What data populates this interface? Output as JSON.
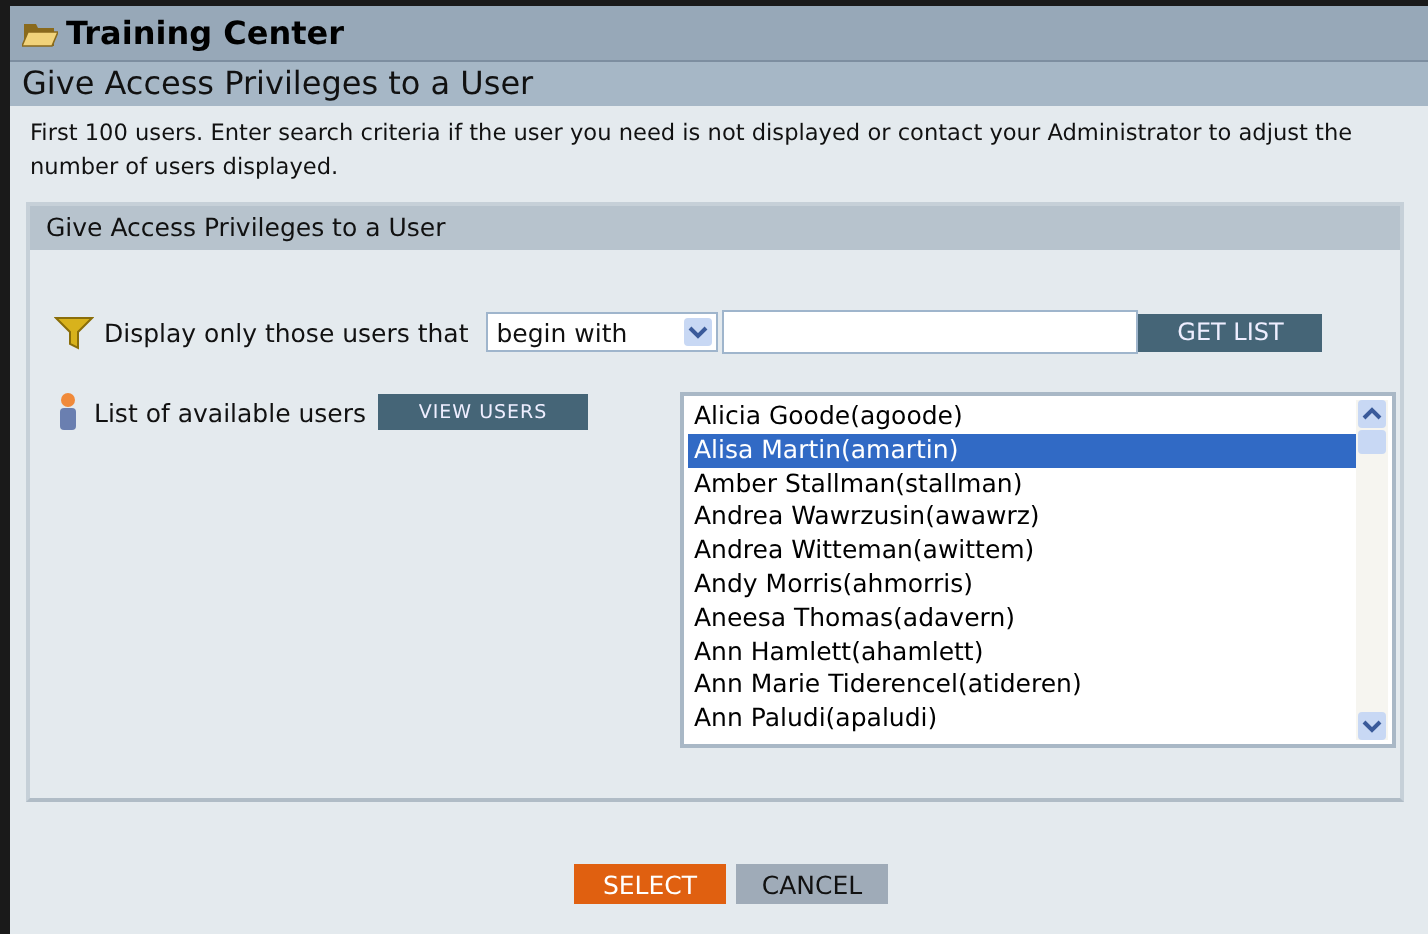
{
  "window": {
    "title": "Training Center"
  },
  "page_title": "Give Access Privileges to a User",
  "intro": "First 100 users. Enter search criteria if the user you need is not displayed or contact your Administrator to adjust the number of users displayed.",
  "section": {
    "title": "Give Access Privileges to a User"
  },
  "filter": {
    "label": "Display only those users that",
    "condition": "begin with",
    "button": "GET LIST"
  },
  "users": {
    "label": "List of available users",
    "button": "VIEW USERS",
    "items": [
      {
        "text": "Alicia Goode(agoode)",
        "selected": false
      },
      {
        "text": "Alisa Martin(amartin)",
        "selected": true
      },
      {
        "text": "Amber Stallman(stallman)",
        "selected": false
      },
      {
        "text": "Andrea Wawrzusin(awawrz)",
        "selected": false
      },
      {
        "text": "Andrea Witteman(awittem)",
        "selected": false
      },
      {
        "text": "Andy Morris(ahmorris)",
        "selected": false
      },
      {
        "text": "Aneesa Thomas(adavern)",
        "selected": false
      },
      {
        "text": "Ann Hamlett(ahamlett)",
        "selected": false
      },
      {
        "text": "Ann Marie Tiderencel(atideren)",
        "selected": false
      },
      {
        "text": "Ann Paludi(apaludi)",
        "selected": false
      }
    ]
  },
  "buttons": [
    {
      "label": "SELECT",
      "kind": "primary"
    },
    {
      "label": "CANCEL",
      "kind": "secondary"
    }
  ]
}
